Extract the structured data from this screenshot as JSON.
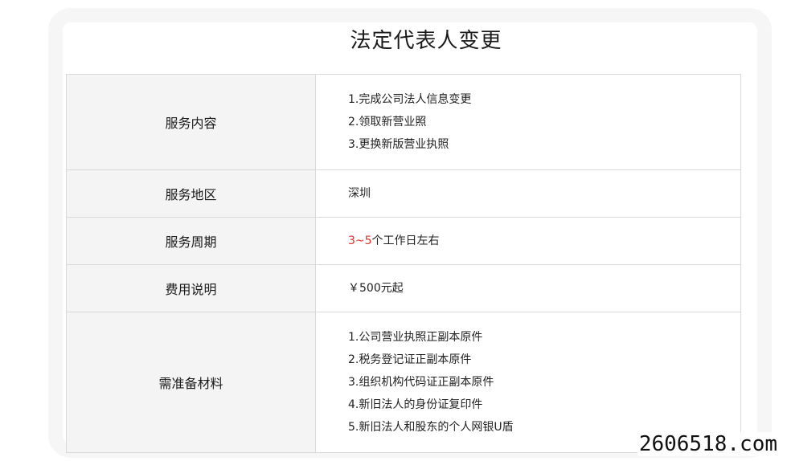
{
  "title": "法定代表人变更",
  "rows": [
    {
      "label": "服务内容",
      "lines": [
        "1.完成公司法人信息变更",
        "2.领取新营业照",
        "3.更换新版营业执照"
      ]
    },
    {
      "label": "服务地区",
      "lines": [
        "深圳"
      ]
    },
    {
      "label": "服务周期",
      "highlight": "3~5",
      "rest": "个工作日左右",
      "highlight_color": "#e0302a"
    },
    {
      "label": "费用说明",
      "lines": [
        "￥500元起"
      ]
    },
    {
      "label": "需准备材料",
      "lines": [
        "1.公司营业执照正副本原件",
        "2.税务登记证正副本原件",
        "3.组织机构代码证正副本原件",
        "4.新旧法人的身份证复印件",
        "5.新旧法人和股东的个人网银U盾"
      ]
    }
  ],
  "watermark": "2606518.com"
}
